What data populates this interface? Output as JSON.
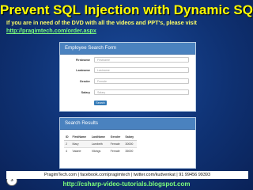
{
  "slide": {
    "title": "Prevent SQL Injection with Dynamic SQL",
    "notice": "If you are in need of the DVD with all the videos and PPT's, please visit",
    "notice_link": "http://pragimtech.com/order.aspx",
    "slide_number": "3",
    "footer_text": "PragimTech.com | facebook.com/pragimtech | twitter.com/kudvenkat | 91 99456 99393",
    "footer_link": "http://csharp-video-tutorials.blogspot.com"
  },
  "form": {
    "heading": "Employee Search Form",
    "fields": [
      {
        "label": "Firstname",
        "placeholder": "Firstname"
      },
      {
        "label": "Lastname",
        "placeholder": "Lastname"
      },
      {
        "label": "Gender",
        "placeholder": "Female"
      },
      {
        "label": "Salary",
        "placeholder": "Salary"
      }
    ],
    "search_label": "Search"
  },
  "results": {
    "heading": "Search Results",
    "columns": [
      "ID",
      "FirstName",
      "LastName",
      "Gender",
      "Salary"
    ],
    "rows": [
      [
        "2",
        "Mary",
        "Lambeth",
        "Female",
        "30000"
      ],
      [
        "4",
        "Valarie",
        "Vikings",
        "Female",
        "35000"
      ]
    ]
  }
}
